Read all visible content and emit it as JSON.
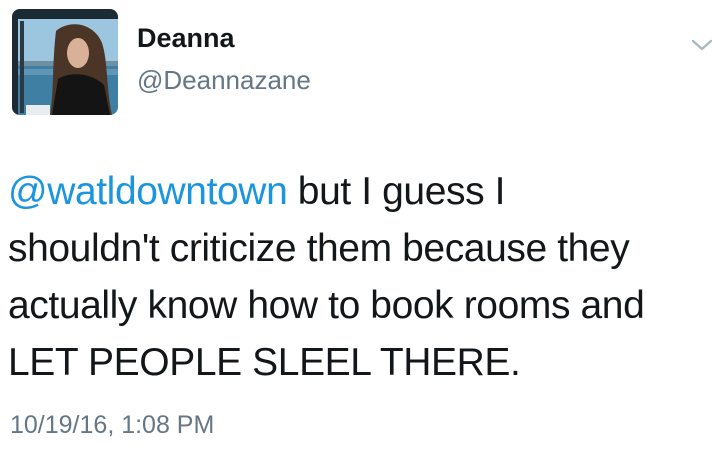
{
  "author": {
    "display_name": "Deanna",
    "handle": "@Deannazane",
    "avatar_icon": "profile-photo"
  },
  "menu_icon": "chevron-down-icon",
  "tweet": {
    "mention": "@watldowntown",
    "line1_rest": " but I guess I",
    "line2": "shouldn't criticize them because they",
    "line3": "actually know how to book rooms and",
    "line4": "LET PEOPLE SLEEL THERE."
  },
  "timestamp": "10/19/16, 1:08 PM",
  "colors": {
    "link": "#1b95e0",
    "text": "#14171a",
    "secondary": "#657786"
  }
}
